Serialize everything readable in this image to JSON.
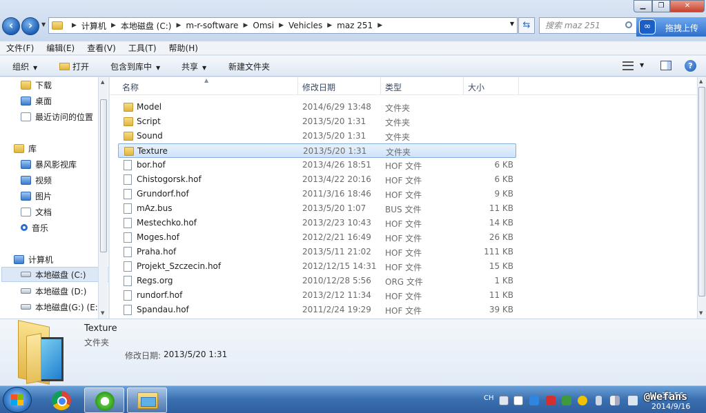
{
  "address": {
    "crumbs": [
      "计算机",
      "本地磁盘 (C:)",
      "m-r-software",
      "Omsi",
      "Vehicles",
      "maz 251"
    ],
    "search_placeholder": "搜索 maz 251",
    "upload_label": "拖拽上传"
  },
  "menu": [
    "文件(F)",
    "编辑(E)",
    "查看(V)",
    "工具(T)",
    "帮助(H)"
  ],
  "toolbar": {
    "organize": "组织",
    "open": "打开",
    "include_library": "包含到库中",
    "share": "共享",
    "new_folder": "新建文件夹"
  },
  "nav": [
    {
      "label": "下载",
      "icon": "download-folder-icon"
    },
    {
      "label": "桌面",
      "icon": "desktop-icon"
    },
    {
      "label": "最近访问的位置",
      "icon": "recent-places-icon"
    },
    {
      "label": "库",
      "icon": "library-icon"
    },
    {
      "label": "暴风影视库",
      "icon": "video-library-icon"
    },
    {
      "label": "视频",
      "icon": "videos-icon"
    },
    {
      "label": "图片",
      "icon": "pictures-icon"
    },
    {
      "label": "文档",
      "icon": "documents-icon"
    },
    {
      "label": "音乐",
      "icon": "music-icon"
    },
    {
      "label": "计算机",
      "icon": "computer-icon"
    },
    {
      "label": "本地磁盘 (C:)",
      "icon": "drive-c-icon",
      "selected": true
    },
    {
      "label": "本地磁盘 (D:)",
      "icon": "drive-d-icon"
    },
    {
      "label": "本地磁盘(G:) (E:)",
      "icon": "drive-e-icon"
    }
  ],
  "columns": {
    "name": "名称",
    "date": "修改日期",
    "type": "类型",
    "size": "大小"
  },
  "files": [
    {
      "name": "Model",
      "date": "2014/6/29 13:48",
      "type": "文件夹",
      "size": "",
      "kind": "folder"
    },
    {
      "name": "Script",
      "date": "2013/5/20 1:31",
      "type": "文件夹",
      "size": "",
      "kind": "folder"
    },
    {
      "name": "Sound",
      "date": "2013/5/20 1:31",
      "type": "文件夹",
      "size": "",
      "kind": "folder"
    },
    {
      "name": "Texture",
      "date": "2013/5/20 1:31",
      "type": "文件夹",
      "size": "",
      "kind": "folder",
      "selected": true
    },
    {
      "name": "bor.hof",
      "date": "2013/4/26 18:51",
      "type": "HOF 文件",
      "size": "6 KB",
      "kind": "file"
    },
    {
      "name": "Chistogorsk.hof",
      "date": "2013/4/22 20:16",
      "type": "HOF 文件",
      "size": "6 KB",
      "kind": "file"
    },
    {
      "name": "Grundorf.hof",
      "date": "2011/3/16 18:46",
      "type": "HOF 文件",
      "size": "9 KB",
      "kind": "file"
    },
    {
      "name": "mAz.bus",
      "date": "2013/5/20 1:07",
      "type": "BUS 文件",
      "size": "11 KB",
      "kind": "file"
    },
    {
      "name": "Mestechko.hof",
      "date": "2013/2/23 10:43",
      "type": "HOF 文件",
      "size": "14 KB",
      "kind": "file"
    },
    {
      "name": "Moges.hof",
      "date": "2012/2/21 16:49",
      "type": "HOF 文件",
      "size": "26 KB",
      "kind": "file"
    },
    {
      "name": "Praha.hof",
      "date": "2013/5/11 21:02",
      "type": "HOF 文件",
      "size": "111 KB",
      "kind": "file"
    },
    {
      "name": "Projekt_Szczecin.hof",
      "date": "2012/12/15 14:31",
      "type": "HOF 文件",
      "size": "15 KB",
      "kind": "file"
    },
    {
      "name": "Regs.org",
      "date": "2010/12/28 5:56",
      "type": "ORG 文件",
      "size": "1 KB",
      "kind": "file"
    },
    {
      "name": "rundorf.hof",
      "date": "2013/2/12 11:34",
      "type": "HOF 文件",
      "size": "11 KB",
      "kind": "file"
    },
    {
      "name": "Spandau.hof",
      "date": "2011/2/24 19:29",
      "type": "HOF 文件",
      "size": "39 KB",
      "kind": "file"
    }
  ],
  "details": {
    "name": "Texture",
    "type": "文件夹",
    "date_label": "修改日期:",
    "date": "2013/5/20 1:31"
  },
  "taskbar": {
    "lang": "CH",
    "clock_time": "17:56",
    "clock_date": "2014/9/16",
    "watermark": "@Wefans"
  }
}
